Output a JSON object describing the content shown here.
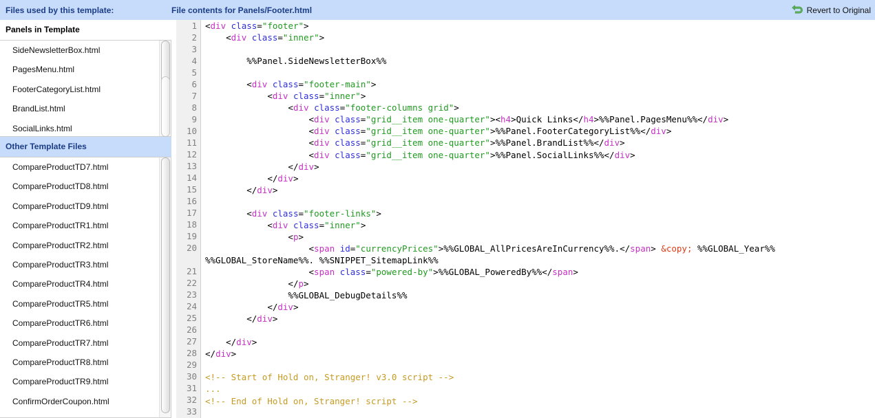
{
  "header": {
    "left_title": "Files used by this template:",
    "mid_title": "File contents for Panels/Footer.html",
    "revert_label": "Revert to Original",
    "revert_icon": "revert-arrow-icon",
    "bar_color": "#c6dcfa",
    "title_color": "#1c3d87"
  },
  "sidebar": {
    "groups": [
      {
        "title": "Panels in Template",
        "style": "plain",
        "items": [
          "SideNewsletterBox.html",
          "PagesMenu.html",
          "FooterCategoryList.html",
          "BrandList.html",
          "SocialLinks.html"
        ]
      },
      {
        "title": "Other Template Files",
        "style": "blue",
        "items": [
          "CompareProductTD7.html",
          "CompareProductTD8.html",
          "CompareProductTD9.html",
          "CompareProductTR1.html",
          "CompareProductTR2.html",
          "CompareProductTR3.html",
          "CompareProductTR4.html",
          "CompareProductTR5.html",
          "CompareProductTR6.html",
          "CompareProductTR7.html",
          "CompareProductTR8.html",
          "CompareProductTR9.html",
          "ConfirmOrderCoupon.html"
        ]
      }
    ]
  },
  "editor": {
    "filename": "Panels/Footer.html",
    "first_line": 1,
    "last_line": 33,
    "line_numbers": [
      1,
      2,
      3,
      4,
      5,
      6,
      7,
      8,
      9,
      10,
      11,
      12,
      13,
      14,
      15,
      16,
      17,
      18,
      19,
      20,
      21,
      22,
      23,
      24,
      25,
      26,
      27,
      28,
      29,
      30,
      31,
      32,
      33
    ],
    "colors": {
      "tag": "#c531c5",
      "attribute": "#2f2fd8",
      "value": "#1f9a1f",
      "comment": "#c79a22",
      "entity": "#dd3b18",
      "text": "#000000",
      "gutter_bg": "#f0f0f0",
      "gutter_fg": "#808080"
    },
    "lines": [
      [
        {
          "t": "txt",
          "s": "<"
        },
        {
          "t": "tag",
          "s": "div"
        },
        {
          "t": "txt",
          "s": " "
        },
        {
          "t": "attr",
          "s": "class"
        },
        {
          "t": "txt",
          "s": "="
        },
        {
          "t": "val",
          "s": "\"footer\""
        },
        {
          "t": "txt",
          "s": ">"
        }
      ],
      [
        {
          "t": "txt",
          "s": "    <"
        },
        {
          "t": "tag",
          "s": "div"
        },
        {
          "t": "txt",
          "s": " "
        },
        {
          "t": "attr",
          "s": "class"
        },
        {
          "t": "txt",
          "s": "="
        },
        {
          "t": "val",
          "s": "\"inner\""
        },
        {
          "t": "txt",
          "s": ">"
        }
      ],
      [],
      [
        {
          "t": "txt",
          "s": "        %%Panel.SideNewsletterBox%%"
        }
      ],
      [],
      [
        {
          "t": "txt",
          "s": "        <"
        },
        {
          "t": "tag",
          "s": "div"
        },
        {
          "t": "txt",
          "s": " "
        },
        {
          "t": "attr",
          "s": "class"
        },
        {
          "t": "txt",
          "s": "="
        },
        {
          "t": "val",
          "s": "\"footer-main\""
        },
        {
          "t": "txt",
          "s": ">"
        }
      ],
      [
        {
          "t": "txt",
          "s": "            <"
        },
        {
          "t": "tag",
          "s": "div"
        },
        {
          "t": "txt",
          "s": " "
        },
        {
          "t": "attr",
          "s": "class"
        },
        {
          "t": "txt",
          "s": "="
        },
        {
          "t": "val",
          "s": "\"inner\""
        },
        {
          "t": "txt",
          "s": ">"
        }
      ],
      [
        {
          "t": "txt",
          "s": "                <"
        },
        {
          "t": "tag",
          "s": "div"
        },
        {
          "t": "txt",
          "s": " "
        },
        {
          "t": "attr",
          "s": "class"
        },
        {
          "t": "txt",
          "s": "="
        },
        {
          "t": "val",
          "s": "\"footer-columns grid\""
        },
        {
          "t": "txt",
          "s": ">"
        }
      ],
      [
        {
          "t": "txt",
          "s": "                    <"
        },
        {
          "t": "tag",
          "s": "div"
        },
        {
          "t": "txt",
          "s": " "
        },
        {
          "t": "attr",
          "s": "class"
        },
        {
          "t": "txt",
          "s": "="
        },
        {
          "t": "val",
          "s": "\"grid__item one-quarter\""
        },
        {
          "t": "txt",
          "s": "><"
        },
        {
          "t": "tag",
          "s": "h4"
        },
        {
          "t": "txt",
          "s": ">Quick Links</"
        },
        {
          "t": "tag",
          "s": "h4"
        },
        {
          "t": "txt",
          "s": ">%%Panel.PagesMenu%%</"
        },
        {
          "t": "tag",
          "s": "div"
        },
        {
          "t": "txt",
          "s": ">"
        }
      ],
      [
        {
          "t": "txt",
          "s": "                    <"
        },
        {
          "t": "tag",
          "s": "div"
        },
        {
          "t": "txt",
          "s": " "
        },
        {
          "t": "attr",
          "s": "class"
        },
        {
          "t": "txt",
          "s": "="
        },
        {
          "t": "val",
          "s": "\"grid__item one-quarter\""
        },
        {
          "t": "txt",
          "s": ">%%Panel.FooterCategoryList%%</"
        },
        {
          "t": "tag",
          "s": "div"
        },
        {
          "t": "txt",
          "s": ">"
        }
      ],
      [
        {
          "t": "txt",
          "s": "                    <"
        },
        {
          "t": "tag",
          "s": "div"
        },
        {
          "t": "txt",
          "s": " "
        },
        {
          "t": "attr",
          "s": "class"
        },
        {
          "t": "txt",
          "s": "="
        },
        {
          "t": "val",
          "s": "\"grid__item one-quarter\""
        },
        {
          "t": "txt",
          "s": ">%%Panel.BrandList%%</"
        },
        {
          "t": "tag",
          "s": "div"
        },
        {
          "t": "txt",
          "s": ">"
        }
      ],
      [
        {
          "t": "txt",
          "s": "                    <"
        },
        {
          "t": "tag",
          "s": "div"
        },
        {
          "t": "txt",
          "s": " "
        },
        {
          "t": "attr",
          "s": "class"
        },
        {
          "t": "txt",
          "s": "="
        },
        {
          "t": "val",
          "s": "\"grid__item one-quarter\""
        },
        {
          "t": "txt",
          "s": ">%%Panel.SocialLinks%%</"
        },
        {
          "t": "tag",
          "s": "div"
        },
        {
          "t": "txt",
          "s": ">"
        }
      ],
      [
        {
          "t": "txt",
          "s": "                </"
        },
        {
          "t": "tag",
          "s": "div"
        },
        {
          "t": "txt",
          "s": ">"
        }
      ],
      [
        {
          "t": "txt",
          "s": "            </"
        },
        {
          "t": "tag",
          "s": "div"
        },
        {
          "t": "txt",
          "s": ">"
        }
      ],
      [
        {
          "t": "txt",
          "s": "        </"
        },
        {
          "t": "tag",
          "s": "div"
        },
        {
          "t": "txt",
          "s": ">"
        }
      ],
      [],
      [
        {
          "t": "txt",
          "s": "        <"
        },
        {
          "t": "tag",
          "s": "div"
        },
        {
          "t": "txt",
          "s": " "
        },
        {
          "t": "attr",
          "s": "class"
        },
        {
          "t": "txt",
          "s": "="
        },
        {
          "t": "val",
          "s": "\"footer-links\""
        },
        {
          "t": "txt",
          "s": ">"
        }
      ],
      [
        {
          "t": "txt",
          "s": "            <"
        },
        {
          "t": "tag",
          "s": "div"
        },
        {
          "t": "txt",
          "s": " "
        },
        {
          "t": "attr",
          "s": "class"
        },
        {
          "t": "txt",
          "s": "="
        },
        {
          "t": "val",
          "s": "\"inner\""
        },
        {
          "t": "txt",
          "s": ">"
        }
      ],
      [
        {
          "t": "txt",
          "s": "                <"
        },
        {
          "t": "tag",
          "s": "p"
        },
        {
          "t": "txt",
          "s": ">"
        }
      ],
      [
        {
          "t": "txt",
          "s": "                    <"
        },
        {
          "t": "tag",
          "s": "span"
        },
        {
          "t": "txt",
          "s": " "
        },
        {
          "t": "attr",
          "s": "id"
        },
        {
          "t": "txt",
          "s": "="
        },
        {
          "t": "val",
          "s": "\"currencyPrices\""
        },
        {
          "t": "txt",
          "s": ">%%GLOBAL_AllPricesAreInCurrency%%.</"
        },
        {
          "t": "tag",
          "s": "span"
        },
        {
          "t": "txt",
          "s": "> "
        },
        {
          "t": "ent",
          "s": "&copy;"
        },
        {
          "t": "txt",
          "s": " %%GLOBAL_Year%% %%GLOBAL_StoreName%%. %%SNIPPET_SitemapLink%%"
        }
      ],
      [
        {
          "t": "txt",
          "s": "                    <"
        },
        {
          "t": "tag",
          "s": "span"
        },
        {
          "t": "txt",
          "s": " "
        },
        {
          "t": "attr",
          "s": "class"
        },
        {
          "t": "txt",
          "s": "="
        },
        {
          "t": "val",
          "s": "\"powered-by\""
        },
        {
          "t": "txt",
          "s": ">%%GLOBAL_PoweredBy%%</"
        },
        {
          "t": "tag",
          "s": "span"
        },
        {
          "t": "txt",
          "s": ">"
        }
      ],
      [
        {
          "t": "txt",
          "s": "                </"
        },
        {
          "t": "tag",
          "s": "p"
        },
        {
          "t": "txt",
          "s": ">"
        }
      ],
      [
        {
          "t": "txt",
          "s": "                %%GLOBAL_DebugDetails%%"
        }
      ],
      [
        {
          "t": "txt",
          "s": "            </"
        },
        {
          "t": "tag",
          "s": "div"
        },
        {
          "t": "txt",
          "s": ">"
        }
      ],
      [
        {
          "t": "txt",
          "s": "        </"
        },
        {
          "t": "tag",
          "s": "div"
        },
        {
          "t": "txt",
          "s": ">"
        }
      ],
      [],
      [
        {
          "t": "txt",
          "s": "    </"
        },
        {
          "t": "tag",
          "s": "div"
        },
        {
          "t": "txt",
          "s": ">"
        }
      ],
      [
        {
          "t": "txt",
          "s": "</"
        },
        {
          "t": "tag",
          "s": "div"
        },
        {
          "t": "txt",
          "s": ">"
        }
      ],
      [],
      [
        {
          "t": "cmt",
          "s": "<!-- Start of Hold on, Stranger! v3.0 script -->"
        }
      ],
      [
        {
          "t": "cmt",
          "s": "..."
        }
      ],
      [
        {
          "t": "cmt",
          "s": "<!-- End of Hold on, Stranger! script -->"
        }
      ],
      []
    ]
  }
}
